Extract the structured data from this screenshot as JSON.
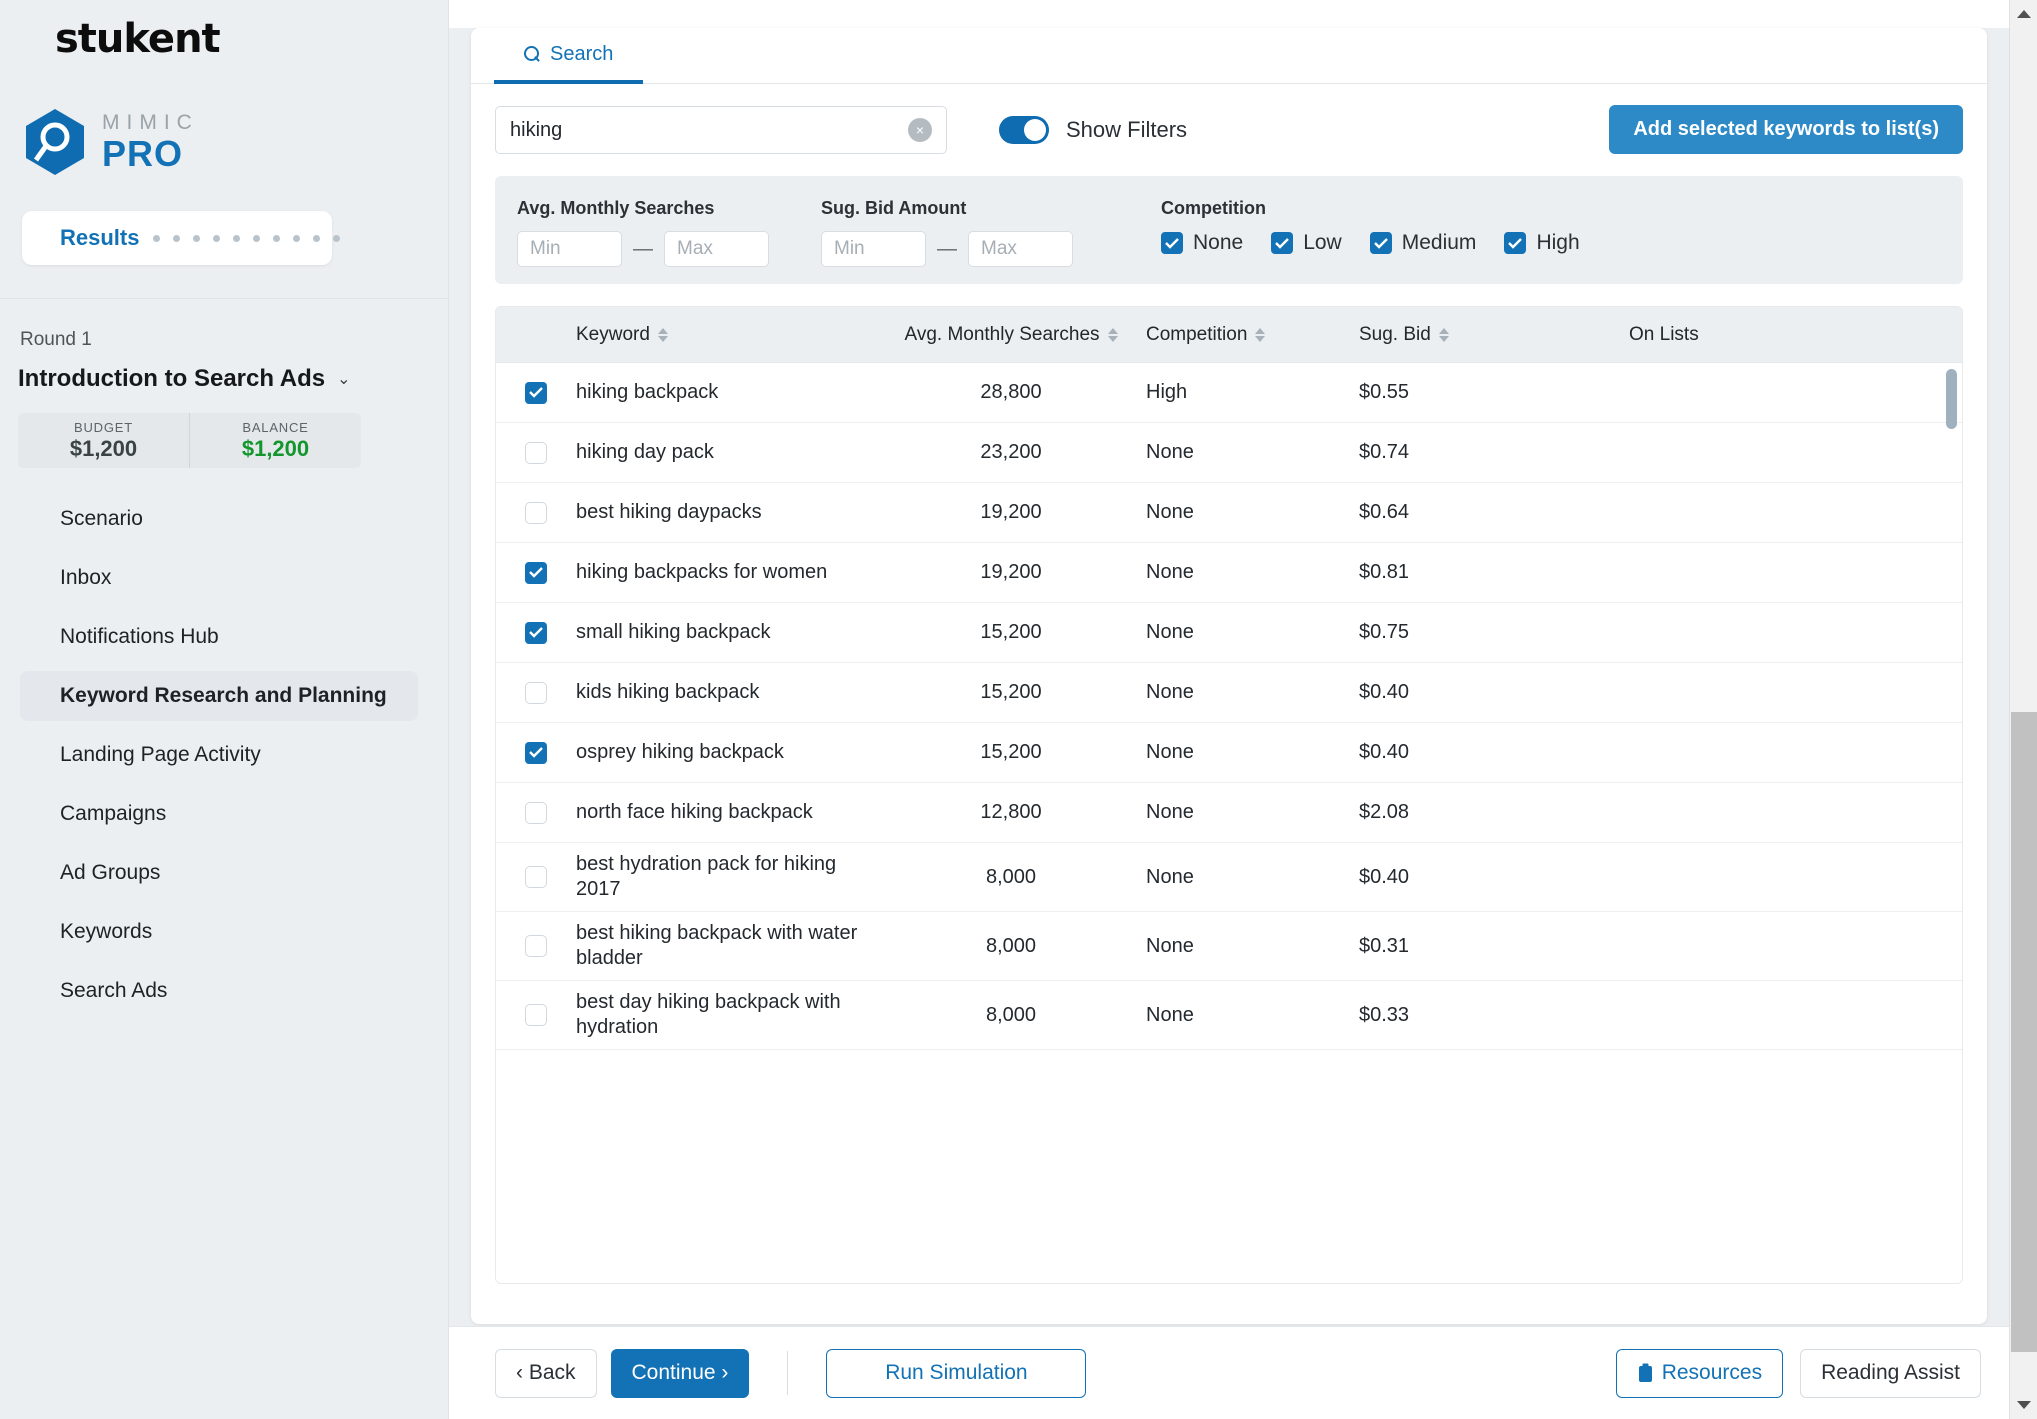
{
  "brand": {
    "company": "stukent",
    "product_word": "MIMIC",
    "product_name": "PRO"
  },
  "sidebar": {
    "results_label": "Results",
    "dots_count": 10,
    "round_label": "Round 1",
    "course_title": "Introduction to Search Ads",
    "chevron": "⌄",
    "budget_key": "BUDGET",
    "budget_value": "$1,200",
    "balance_key": "BALANCE",
    "balance_value": "$1,200",
    "nav_items": [
      {
        "label": "Scenario",
        "active": false
      },
      {
        "label": "Inbox",
        "active": false
      },
      {
        "label": "Notifications Hub",
        "active": false
      },
      {
        "label": "Keyword Research and Planning",
        "active": true
      },
      {
        "label": "Landing Page Activity",
        "active": false
      },
      {
        "label": "Campaigns",
        "active": false
      },
      {
        "label": "Ad Groups",
        "active": false
      },
      {
        "label": "Keywords",
        "active": false
      },
      {
        "label": "Search Ads",
        "active": false
      }
    ]
  },
  "tabs": [
    {
      "label": "Search",
      "icon": "search-icon",
      "active": true
    }
  ],
  "search": {
    "value": "hiking",
    "placeholder": "",
    "clear_glyph": "×",
    "toggle_label": "Show Filters",
    "toggle_on": true,
    "add_button": "Add selected keywords to list(s)"
  },
  "filters": {
    "avg_searches_label": "Avg. Monthly Searches",
    "avg_min_placeholder": "Min",
    "avg_max_placeholder": "Max",
    "avg_min_value": "",
    "avg_max_value": "",
    "bid_label": "Sug. Bid Amount",
    "bid_min_placeholder": "Min",
    "bid_max_placeholder": "Max",
    "bid_min_value": "",
    "bid_max_value": "",
    "dash": "—",
    "competition_label": "Competition",
    "competition_options": [
      {
        "label": "None",
        "checked": true
      },
      {
        "label": "Low",
        "checked": true
      },
      {
        "label": "Medium",
        "checked": true
      },
      {
        "label": "High",
        "checked": true
      }
    ]
  },
  "table": {
    "columns": [
      {
        "label": "Keyword",
        "sortable": true
      },
      {
        "label": "Avg. Monthly Searches",
        "sortable": true
      },
      {
        "label": "Competition",
        "sortable": true
      },
      {
        "label": "Sug. Bid",
        "sortable": true
      },
      {
        "label": "On Lists",
        "sortable": false
      }
    ],
    "rows": [
      {
        "selected": true,
        "keyword": "hiking backpack",
        "avg_monthly_searches": "28,800",
        "competition": "High",
        "sug_bid": "$0.55",
        "on_lists": ""
      },
      {
        "selected": false,
        "keyword": "hiking day pack",
        "avg_monthly_searches": "23,200",
        "competition": "None",
        "sug_bid": "$0.74",
        "on_lists": ""
      },
      {
        "selected": false,
        "keyword": "best hiking daypacks",
        "avg_monthly_searches": "19,200",
        "competition": "None",
        "sug_bid": "$0.64",
        "on_lists": ""
      },
      {
        "selected": true,
        "keyword": "hiking backpacks for women",
        "avg_monthly_searches": "19,200",
        "competition": "None",
        "sug_bid": "$0.81",
        "on_lists": ""
      },
      {
        "selected": true,
        "keyword": "small hiking backpack",
        "avg_monthly_searches": "15,200",
        "competition": "None",
        "sug_bid": "$0.75",
        "on_lists": ""
      },
      {
        "selected": false,
        "keyword": "kids hiking backpack",
        "avg_monthly_searches": "15,200",
        "competition": "None",
        "sug_bid": "$0.40",
        "on_lists": ""
      },
      {
        "selected": true,
        "keyword": "osprey hiking backpack",
        "avg_monthly_searches": "15,200",
        "competition": "None",
        "sug_bid": "$0.40",
        "on_lists": ""
      },
      {
        "selected": false,
        "keyword": "north face hiking backpack",
        "avg_monthly_searches": "12,800",
        "competition": "None",
        "sug_bid": "$2.08",
        "on_lists": ""
      },
      {
        "selected": false,
        "keyword": "best hydration pack for hiking 2017",
        "avg_monthly_searches": "8,000",
        "competition": "None",
        "sug_bid": "$0.40",
        "on_lists": ""
      },
      {
        "selected": false,
        "keyword": "best hiking backpack with water bladder",
        "avg_monthly_searches": "8,000",
        "competition": "None",
        "sug_bid": "$0.31",
        "on_lists": ""
      },
      {
        "selected": false,
        "keyword": "best day hiking backpack with hydration",
        "avg_monthly_searches": "8,000",
        "competition": "None",
        "sug_bid": "$0.33",
        "on_lists": ""
      }
    ]
  },
  "footer": {
    "back": "‹ Back",
    "continue": "Continue ›",
    "run_simulation": "Run Simulation",
    "resources": "Resources",
    "reading_assist": "Reading Assist"
  },
  "colors": {
    "accent": "#1272b5",
    "accent_light": "#2d8ac7",
    "sidebar_bg": "#eceff1",
    "balance_green": "#13962e"
  }
}
